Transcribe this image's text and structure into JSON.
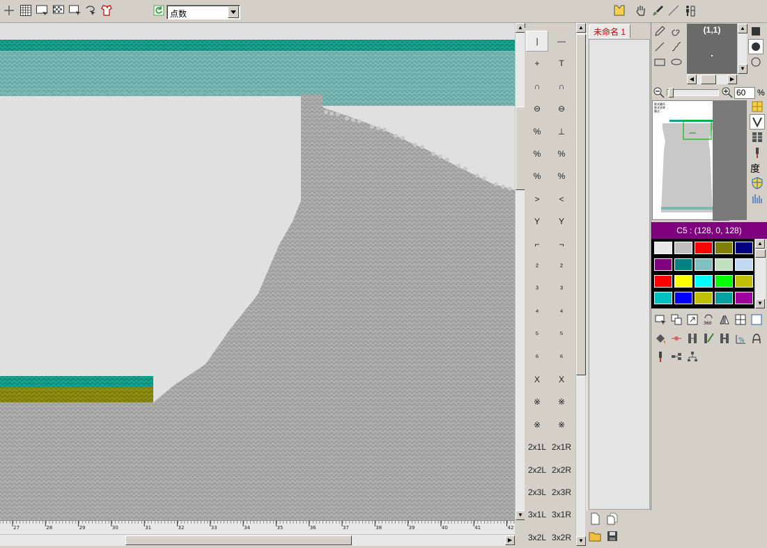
{
  "toolbar": {
    "mode_value": "点数",
    "tools": [
      "crosshair-icon",
      "grid-icon",
      "select-rect-icon",
      "checker-select-icon",
      "select-corner-icon",
      "lasso-icon",
      "shirt-icon",
      "refresh-icon"
    ],
    "right_tools": [
      "vest-icon",
      "hand-icon",
      "brush-icon",
      "line-icon",
      "figure-icon"
    ]
  },
  "canvas": {
    "ruler_ticks": [
      "27",
      "28",
      "29",
      "30",
      "31",
      "32",
      "33",
      "34",
      "35",
      "36",
      "37",
      "38",
      "39",
      "40",
      "41",
      "42"
    ]
  },
  "stitch_palette": {
    "rows": [
      [
        "|",
        "—"
      ],
      [
        "+",
        "T"
      ],
      [
        "∩",
        "∩"
      ],
      [
        "⊖",
        "⊖"
      ],
      [
        "%",
        "⊥"
      ],
      [
        "%",
        "%"
      ],
      [
        "%",
        "%"
      ],
      [
        ">",
        "<"
      ],
      [
        "Y",
        "Y"
      ],
      [
        "⌐",
        "¬"
      ],
      [
        "²",
        "²"
      ],
      [
        "³",
        "³"
      ],
      [
        "⁴",
        "⁴"
      ],
      [
        "⁵",
        "⁵"
      ],
      [
        "⁶",
        "⁶"
      ],
      [
        "X",
        "X"
      ],
      [
        "※",
        "※"
      ],
      [
        "※",
        "※"
      ],
      [
        "2x1L",
        "2x1R"
      ],
      [
        "2x2L",
        "2x2R"
      ],
      [
        "2x3L",
        "2x3R"
      ],
      [
        "3x1L",
        "3x1R"
      ],
      [
        "3x2L",
        "3x2R"
      ]
    ]
  },
  "file_panel": {
    "tab_label": "未命名 1"
  },
  "right_panel": {
    "coord_label": "(1,1)",
    "zoom_value": "60",
    "zoom_unit": "%",
    "preview_lines": [
      "款式编号 ...",
      "款式名称 ...",
      "备注 ..."
    ],
    "degree_label": "度",
    "color_label": "C5 : (128, 0, 128)",
    "swatches": [
      "#e8e8e8",
      "#c0c0c0",
      "#ff0000",
      "#808000",
      "#000080",
      "#800080",
      "#008080",
      "#80c0c0",
      "#c0e0c0",
      "#c0d8f0",
      "#ff0000",
      "#ffff00",
      "#00ffff",
      "#00ff00",
      "#c0c000",
      "#00c0c0",
      "#0000ff",
      "#c0c000",
      "#00a0a0",
      "#a000a0"
    ]
  },
  "colors": {
    "teal": "#1aa08e",
    "teal_light": "#7cb8b4",
    "olive": "#8f8f12",
    "knit_gray": "#a8a8a8",
    "purple": "#7f007f"
  }
}
